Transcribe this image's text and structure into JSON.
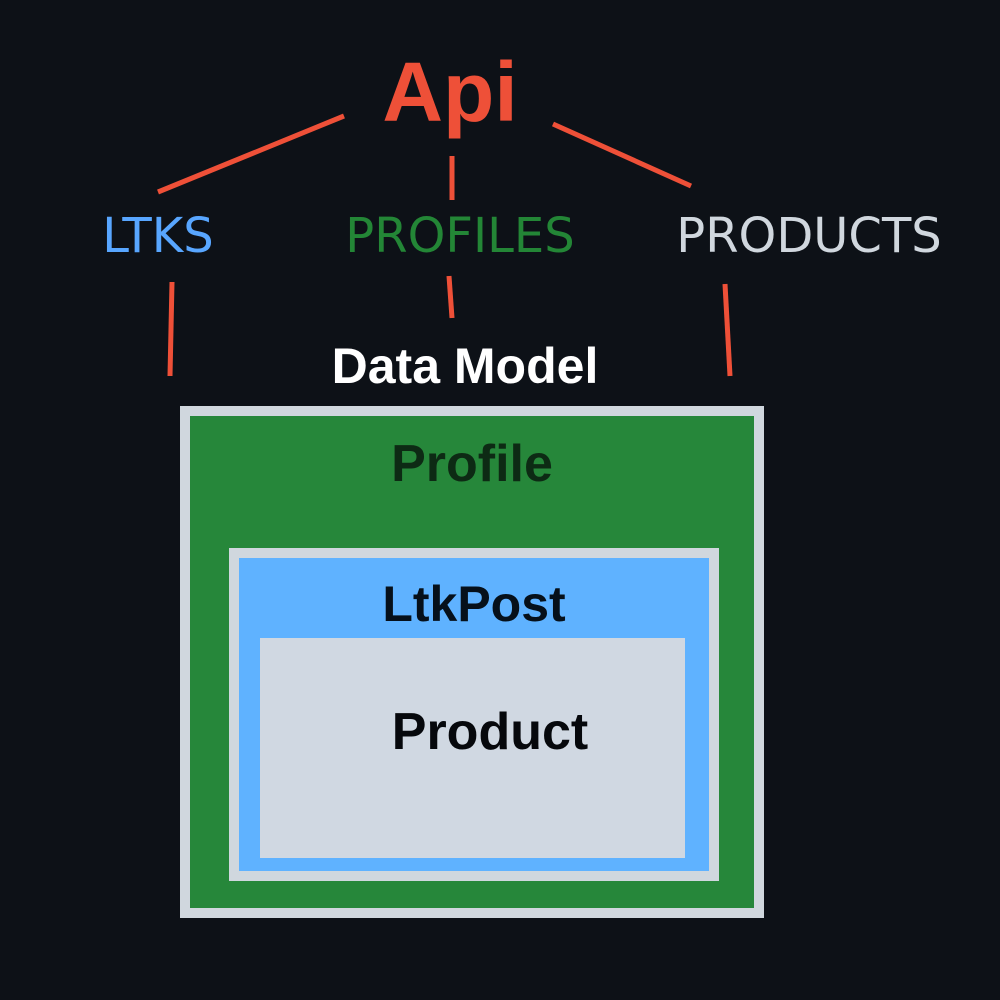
{
  "diagram": {
    "root": {
      "label": "Api"
    },
    "endpoints": [
      {
        "label": "LTKS"
      },
      {
        "label": "PROFILES"
      },
      {
        "label": "PRODUCTS"
      }
    ],
    "model_title": "Data Model",
    "model": {
      "outer": {
        "label": "Profile"
      },
      "middle": {
        "label": "LtkPost"
      },
      "inner": {
        "label": "Product"
      }
    }
  },
  "colors": {
    "background": "#0d1117",
    "accent_red": "#ee5038",
    "ltks_blue": "#58a6ff",
    "profiles_green": "#238636",
    "products_gray": "#d0d7de",
    "profile_box": "#26873a",
    "ltkpost_box": "#5fb2ff",
    "product_box": "#d0d8e2",
    "box_border": "#d0d7de"
  }
}
